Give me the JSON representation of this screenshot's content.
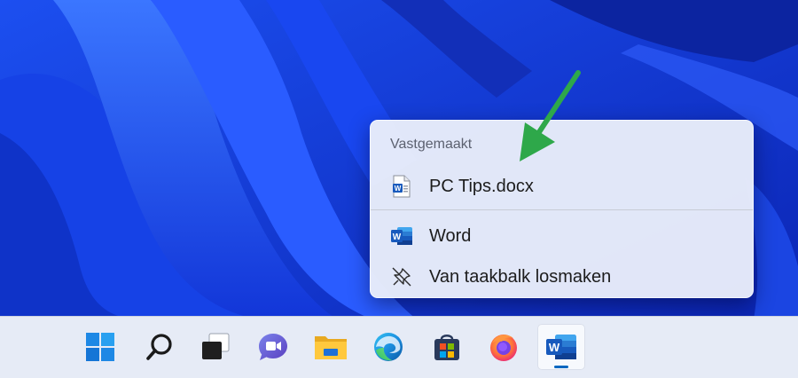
{
  "jump_list": {
    "section_title": "Vastgemaakt",
    "pinned_items": [
      {
        "label": "PC Tips.docx",
        "icon": "word-document-icon"
      }
    ],
    "tasks": [
      {
        "label": "Word",
        "icon": "word-app-icon"
      },
      {
        "label": "Van taakbalk losmaken",
        "icon": "unpin-icon"
      }
    ]
  },
  "annotation": {
    "arrow_color": "#2ea84a"
  },
  "taskbar": {
    "apps": [
      {
        "name": "start",
        "icon": "windows-start-icon"
      },
      {
        "name": "search",
        "icon": "search-icon"
      },
      {
        "name": "task-view",
        "icon": "task-view-icon"
      },
      {
        "name": "chat",
        "icon": "teams-chat-icon"
      },
      {
        "name": "file-explorer",
        "icon": "folder-icon"
      },
      {
        "name": "edge",
        "icon": "edge-browser-icon"
      },
      {
        "name": "store",
        "icon": "microsoft-store-icon"
      },
      {
        "name": "firefox",
        "icon": "firefox-icon"
      },
      {
        "name": "word",
        "icon": "word-app-icon",
        "active": true
      }
    ]
  },
  "colors": {
    "wallpaper_base": "#0a2fd6",
    "word_blue": "#185abd",
    "accent": "#0067c0",
    "taskbar_bg": "#e6ebf6"
  }
}
